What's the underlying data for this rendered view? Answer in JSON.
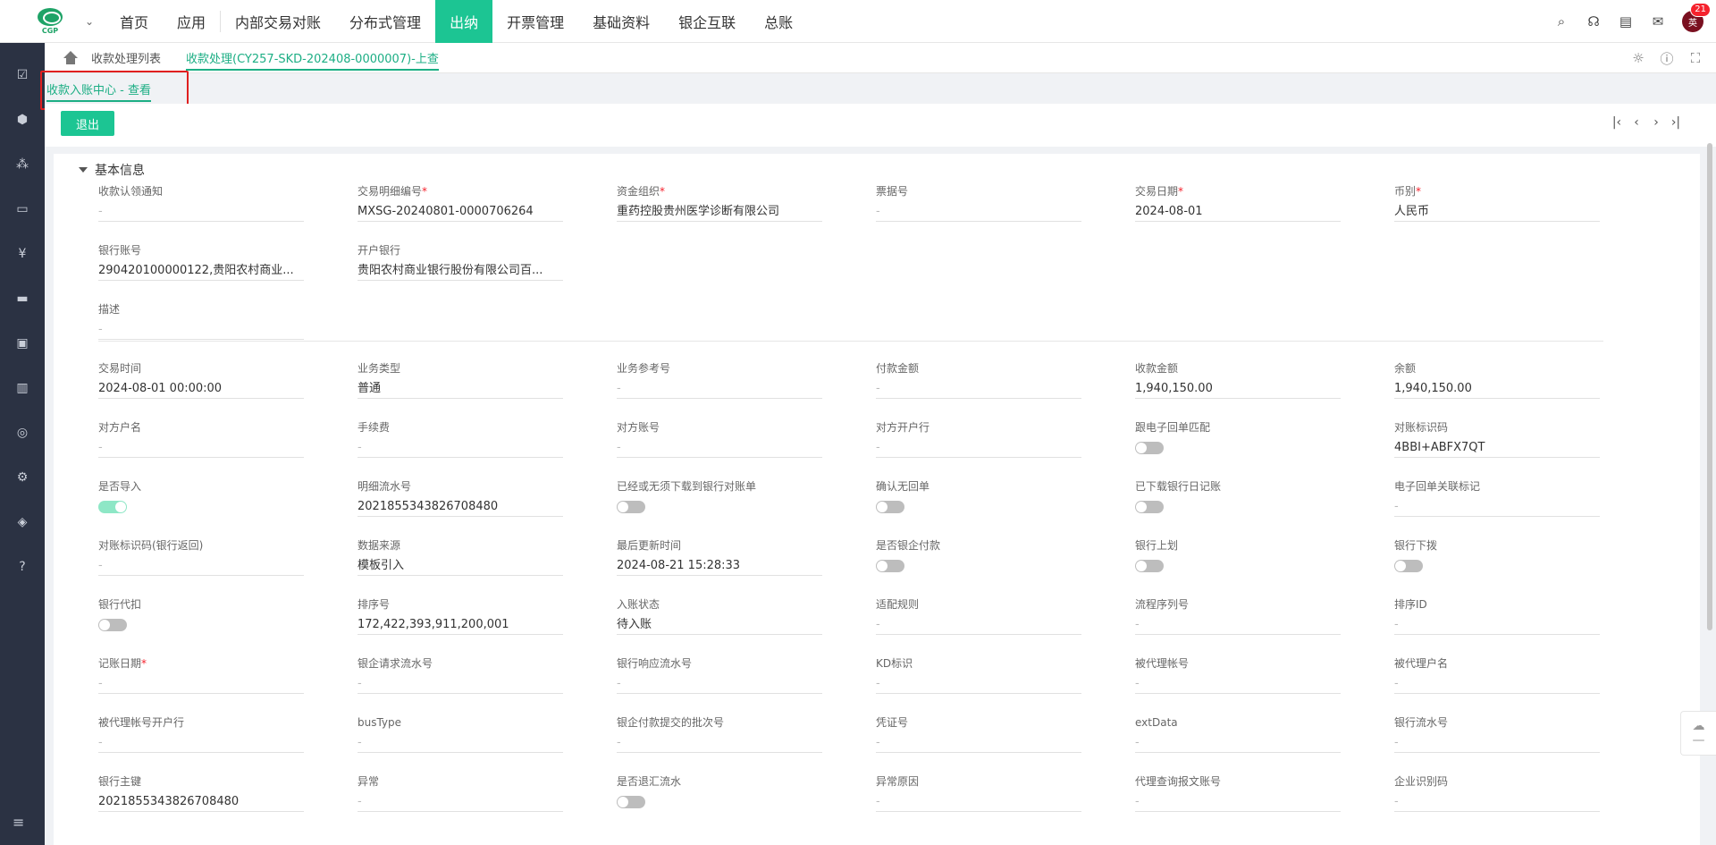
{
  "logo": {
    "text": "CGP"
  },
  "nav": [
    "首页",
    "应用",
    "内部交易对账",
    "分布式管理",
    "出纳",
    "开票管理",
    "基础资料",
    "银企互联",
    "总账"
  ],
  "nav_active": 4,
  "user": {
    "avatar": "英",
    "badge": "21"
  },
  "breadcrumb": {
    "list": "收款处理列表",
    "current": "收款处理(CY257-SKD-202408-0000007)-上查"
  },
  "subtab": "收款入账中心 - 查看",
  "toolbar": {
    "exit": "退出"
  },
  "section": "基本信息",
  "fields": [
    {
      "label": "收款认领通知",
      "value": "-",
      "req": false
    },
    {
      "label": "交易明细编号",
      "value": "MXSG-20240801-0000706264",
      "req": true
    },
    {
      "label": "资金组织",
      "value": "重药控股贵州医学诊断有限公司",
      "req": true
    },
    {
      "label": "票据号",
      "value": "-",
      "req": false
    },
    {
      "label": "交易日期",
      "value": "2024-08-01",
      "req": true
    },
    {
      "label": "币别",
      "value": "人民币",
      "req": true
    },
    {
      "label": "银行账号",
      "value": "290420100000122,贵阳农村商业...",
      "req": false
    },
    {
      "label": "开户银行",
      "value": "贵阳农村商业银行股份有限公司百...",
      "req": false
    },
    {
      "label": "描述",
      "value": "-",
      "req": false
    },
    {
      "label": "交易时间",
      "value": "2024-08-01 00:00:00",
      "req": false
    },
    {
      "label": "业务类型",
      "value": "普通",
      "req": false
    },
    {
      "label": "业务参考号",
      "value": "-",
      "req": false
    },
    {
      "label": "付款金额",
      "value": "-",
      "req": false
    },
    {
      "label": "收款金额",
      "value": "1,940,150.00",
      "req": false
    },
    {
      "label": "余额",
      "value": "1,940,150.00",
      "req": false
    },
    {
      "label": "对方户名",
      "value": "-",
      "req": false
    },
    {
      "label": "手续费",
      "value": "-",
      "req": false
    },
    {
      "label": "对方账号",
      "value": "-",
      "req": false
    },
    {
      "label": "对方开户行",
      "value": "-",
      "req": false
    },
    {
      "label": "跟电子回单匹配",
      "toggle": false
    },
    {
      "label": "对账标识码",
      "value": "4BBI+ABFX7QT",
      "req": false
    },
    {
      "label": "是否导入",
      "toggle": true
    },
    {
      "label": "明细流水号",
      "value": "2021855343826708480",
      "req": false
    },
    {
      "label": "已经或无须下载到银行对账单",
      "toggle": false
    },
    {
      "label": "确认无回单",
      "toggle": false
    },
    {
      "label": "已下载银行日记账",
      "toggle": false
    },
    {
      "label": "电子回单关联标记",
      "value": "-",
      "req": false
    },
    {
      "label": "对账标识码(银行返回)",
      "value": "-",
      "req": false
    },
    {
      "label": "数据来源",
      "value": "模板引入",
      "req": false
    },
    {
      "label": "最后更新时间",
      "value": "2024-08-21 15:28:33",
      "req": false
    },
    {
      "label": "是否银企付款",
      "toggle": false
    },
    {
      "label": "银行上划",
      "toggle": false
    },
    {
      "label": "银行下拨",
      "toggle": false
    },
    {
      "label": "银行代扣",
      "toggle": false
    },
    {
      "label": "排序号",
      "value": "172,422,393,911,200,001",
      "req": false
    },
    {
      "label": "入账状态",
      "value": "待入账",
      "req": false
    },
    {
      "label": "适配规则",
      "value": "-",
      "req": false
    },
    {
      "label": "流程序列号",
      "value": "-",
      "req": false
    },
    {
      "label": "排序ID",
      "value": "-",
      "req": false
    },
    {
      "label": "记账日期",
      "value": "-",
      "req": true
    },
    {
      "label": "银企请求流水号",
      "value": "-",
      "req": false
    },
    {
      "label": "银行响应流水号",
      "value": "-",
      "req": false
    },
    {
      "label": "KD标识",
      "value": "-",
      "req": false
    },
    {
      "label": "被代理帐号",
      "value": "-",
      "req": false
    },
    {
      "label": "被代理户名",
      "value": "-",
      "req": false
    },
    {
      "label": "被代理帐号开户行",
      "value": "-",
      "req": false
    },
    {
      "label": "busType",
      "value": "-",
      "req": false
    },
    {
      "label": "银企付款提交的批次号",
      "value": "-",
      "req": false
    },
    {
      "label": "凭证号",
      "value": "-",
      "req": false
    },
    {
      "label": "extData",
      "value": "-",
      "req": false
    },
    {
      "label": "银行流水号",
      "value": "-",
      "req": false
    },
    {
      "label": "银行主键",
      "value": "2021855343826708480",
      "req": false
    },
    {
      "label": "异常",
      "value": "-",
      "req": false
    },
    {
      "label": "是否退汇流水",
      "toggle": false
    },
    {
      "label": "异常原因",
      "value": "-",
      "req": false
    },
    {
      "label": "代理查询报文账号",
      "value": "-",
      "req": false
    },
    {
      "label": "企业识别码",
      "value": "-",
      "req": false
    }
  ]
}
